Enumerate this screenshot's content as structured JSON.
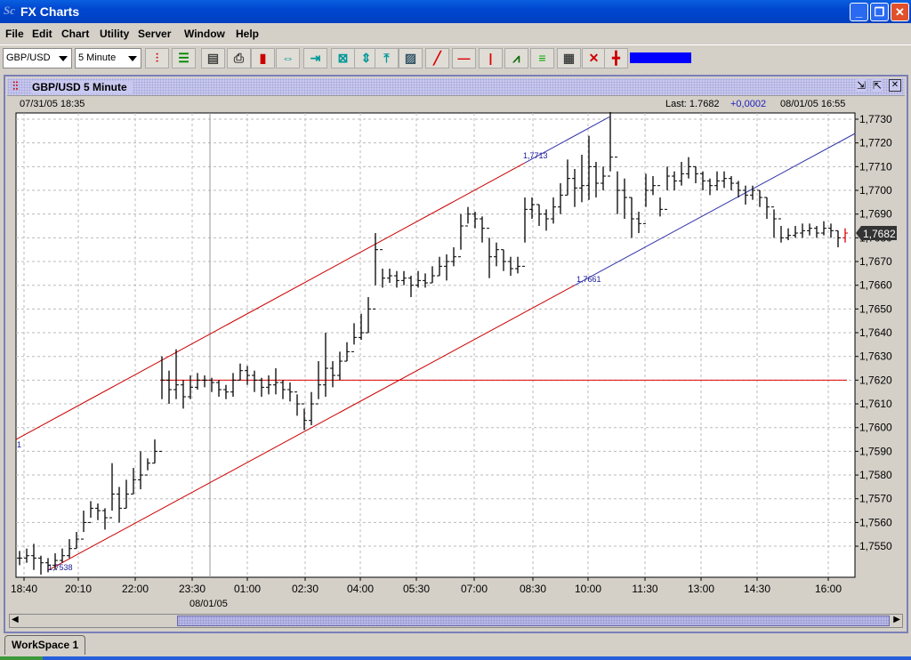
{
  "window": {
    "title": "FX Charts",
    "logo": "Sc"
  },
  "menu": [
    "File",
    "Edit",
    "Chart",
    "Utility",
    "Server",
    "Window",
    "Help"
  ],
  "toolbar": {
    "symbol": "GBP/USD",
    "interval": "5 Minute",
    "buttons": [
      "bar-chart-icon",
      "list-icon",
      "server-icon",
      "print-icon",
      "candle-icon",
      "expand-horizontal-icon",
      "compress-horizontal-icon",
      "fit-icon",
      "expand-vertical-icon",
      "compress-vertical-icon",
      "zoom-select-icon",
      "trendline-icon",
      "horizontal-line-icon",
      "vertical-line-icon",
      "indicator-icon",
      "fibonacci-icon",
      "grid-icon",
      "delete-icon",
      "crosshair-icon"
    ],
    "color_swatch": "#0000ff"
  },
  "chart_window": {
    "title": "GBP/USD 5 Minute",
    "start_time": "07/31/05 18:35",
    "last_label": "Last: 1.7682",
    "change": "+0,0002",
    "end_time": "08/01/05 16:55",
    "date_label": "08/01/05",
    "workspace_tab": "WorkSpace 1"
  },
  "chart_data": {
    "type": "ohlc-bar",
    "ylim": [
      1.7535,
      1.7735
    ],
    "y_ticks": [
      "1,7730",
      "1,7720",
      "1,7710",
      "1,7700",
      "1,7690",
      "1,7680",
      "1,7670",
      "1,7660",
      "1,7650",
      "1,7640",
      "1,7630",
      "1,7620",
      "1,7610",
      "1,7600",
      "1,7590",
      "1,7580",
      "1,7570",
      "1,7560",
      "1,7550"
    ],
    "x_ticks": [
      "18:40",
      "20:10",
      "22:00",
      "23:30",
      "01:00",
      "02:30",
      "04:00",
      "05:30",
      "07:00",
      "08:30",
      "10:00",
      "11:30",
      "13:00",
      "14:30",
      "16:00"
    ],
    "last_price": "1,7682",
    "bars_format": [
      "close",
      "high",
      "low"
    ],
    "bars": [
      [
        1.7545,
        1.7548,
        1.7542
      ],
      [
        1.7546,
        1.7549,
        1.7543
      ],
      [
        1.7545,
        1.7551,
        1.754
      ],
      [
        1.7543,
        1.7546,
        1.7538
      ],
      [
        1.7542,
        1.7545,
        1.7539
      ],
      [
        1.7544,
        1.7547,
        1.754
      ],
      [
        1.7546,
        1.7549,
        1.7543
      ],
      [
        1.7549,
        1.7553,
        1.7545
      ],
      [
        1.7553,
        1.7556,
        1.7549
      ],
      [
        1.756,
        1.7565,
        1.7556
      ],
      [
        1.7566,
        1.7569,
        1.7562
      ],
      [
        1.7565,
        1.7568,
        1.7561
      ],
      [
        1.7562,
        1.7566,
        1.7557
      ],
      [
        1.7572,
        1.7585,
        1.7565
      ],
      [
        1.7566,
        1.7575,
        1.756
      ],
      [
        1.7572,
        1.7578,
        1.7566
      ],
      [
        1.7578,
        1.7583,
        1.7572
      ],
      [
        1.758,
        1.759,
        1.7574
      ],
      [
        1.7585,
        1.7587,
        1.7582
      ],
      [
        1.759,
        1.7595,
        1.7585
      ],
      [
        1.762,
        1.763,
        1.7612
      ],
      [
        1.7616,
        1.7624,
        1.761
      ],
      [
        1.7618,
        1.7633,
        1.7612
      ],
      [
        1.7613,
        1.762,
        1.7608
      ],
      [
        1.7617,
        1.7622,
        1.7612
      ],
      [
        1.762,
        1.7623,
        1.7616
      ],
      [
        1.762,
        1.7622,
        1.7617
      ],
      [
        1.7619,
        1.7621,
        1.7615
      ],
      [
        1.7616,
        1.762,
        1.7613
      ],
      [
        1.7615,
        1.7618,
        1.7612
      ],
      [
        1.762,
        1.7623,
        1.7613
      ],
      [
        1.7624,
        1.7627,
        1.762
      ],
      [
        1.7622,
        1.7626,
        1.7618
      ],
      [
        1.762,
        1.7624,
        1.7615
      ],
      [
        1.7617,
        1.7621,
        1.7613
      ],
      [
        1.7618,
        1.7622,
        1.7614
      ],
      [
        1.7619,
        1.7625,
        1.7614
      ],
      [
        1.7616,
        1.762,
        1.7612
      ],
      [
        1.7615,
        1.7619,
        1.7611
      ],
      [
        1.761,
        1.7614,
        1.7605
      ],
      [
        1.7603,
        1.7608,
        1.7599
      ],
      [
        1.761,
        1.7615,
        1.7601
      ],
      [
        1.7618,
        1.7628,
        1.7612
      ],
      [
        1.7625,
        1.764,
        1.7613
      ],
      [
        1.7622,
        1.7628,
        1.7617
      ],
      [
        1.7628,
        1.7632,
        1.762
      ],
      [
        1.7632,
        1.7636,
        1.7628
      ],
      [
        1.7638,
        1.7644,
        1.7635
      ],
      [
        1.764,
        1.7648,
        1.7637
      ],
      [
        1.765,
        1.7655,
        1.764
      ],
      [
        1.7675,
        1.7682,
        1.766
      ],
      [
        1.7663,
        1.7667,
        1.7659
      ],
      [
        1.7664,
        1.7667,
        1.7661
      ],
      [
        1.7662,
        1.7666,
        1.7659
      ],
      [
        1.7663,
        1.7666,
        1.766
      ],
      [
        1.766,
        1.7664,
        1.7655
      ],
      [
        1.7662,
        1.7666,
        1.7659
      ],
      [
        1.7661,
        1.7665,
        1.7659
      ],
      [
        1.7664,
        1.7668,
        1.7661
      ],
      [
        1.7668,
        1.7672,
        1.7664
      ],
      [
        1.767,
        1.7673,
        1.7662
      ],
      [
        1.7672,
        1.7676,
        1.7668
      ],
      [
        1.7685,
        1.769,
        1.7675
      ],
      [
        1.769,
        1.7693,
        1.7686
      ],
      [
        1.7688,
        1.7691,
        1.7684
      ],
      [
        1.7684,
        1.7689,
        1.7678
      ],
      [
        1.7672,
        1.768,
        1.7663
      ],
      [
        1.7675,
        1.7678,
        1.7668
      ],
      [
        1.767,
        1.7675,
        1.7666
      ],
      [
        1.7667,
        1.7672,
        1.7664
      ],
      [
        1.7668,
        1.7672,
        1.7665
      ],
      [
        1.7692,
        1.7697,
        1.7678
      ],
      [
        1.7694,
        1.7697,
        1.7688
      ],
      [
        1.769,
        1.7694,
        1.7685
      ],
      [
        1.7688,
        1.7692,
        1.7683
      ],
      [
        1.7693,
        1.7697,
        1.7686
      ],
      [
        1.7698,
        1.7703,
        1.769
      ],
      [
        1.7705,
        1.7713,
        1.7698
      ],
      [
        1.7701,
        1.7709,
        1.7693
      ],
      [
        1.7702,
        1.7715,
        1.7695
      ],
      [
        1.771,
        1.7723,
        1.7696
      ],
      [
        1.7703,
        1.7712,
        1.7697
      ],
      [
        1.7706,
        1.771,
        1.77
      ],
      [
        1.7714,
        1.7733,
        1.7708
      ],
      [
        1.77,
        1.7708,
        1.769
      ],
      [
        1.7697,
        1.7705,
        1.7688
      ],
      [
        1.7688,
        1.7697,
        1.768
      ],
      [
        1.7686,
        1.7691,
        1.7682
      ],
      [
        1.77,
        1.7707,
        1.7693
      ],
      [
        1.7702,
        1.7706,
        1.7698
      ],
      [
        1.7692,
        1.7697,
        1.7689
      ],
      [
        1.7706,
        1.771,
        1.77
      ],
      [
        1.7704,
        1.7708,
        1.77
      ],
      [
        1.7707,
        1.7712,
        1.7702
      ],
      [
        1.771,
        1.7714,
        1.7705
      ],
      [
        1.7707,
        1.771,
        1.7703
      ],
      [
        1.7704,
        1.7708,
        1.77
      ],
      [
        1.7702,
        1.7705,
        1.7698
      ],
      [
        1.7704,
        1.7708,
        1.77
      ],
      [
        1.7705,
        1.7708,
        1.7701
      ],
      [
        1.7703,
        1.7706,
        1.77
      ],
      [
        1.77,
        1.7704,
        1.7697
      ],
      [
        1.7698,
        1.7702,
        1.7694
      ],
      [
        1.77,
        1.7702,
        1.7696
      ],
      [
        1.7697,
        1.77,
        1.7693
      ],
      [
        1.7693,
        1.7697,
        1.7688
      ],
      [
        1.7688,
        1.7692,
        1.768
      ],
      [
        1.768,
        1.7685,
        1.7678
      ],
      [
        1.7681,
        1.7684,
        1.7679
      ],
      [
        1.7682,
        1.7685,
        1.768
      ],
      [
        1.7683,
        1.7686,
        1.768
      ],
      [
        1.7684,
        1.7686,
        1.7681
      ],
      [
        1.7682,
        1.7685,
        1.768
      ],
      [
        1.7684,
        1.7687,
        1.7681
      ],
      [
        1.7683,
        1.7686,
        1.768
      ],
      [
        1.768,
        1.7683,
        1.7676
      ],
      [
        1.7682,
        1.7684,
        1.7678
      ]
    ],
    "horizontal_line": 1.762,
    "trendlines": [
      {
        "label": "1,7713",
        "from": [
          1.7595
        ],
        "to": [
          1.7731
        ],
        "colors": [
          "#cc0000",
          "#3333aa"
        ]
      },
      {
        "label": "1,7661",
        "from": [
          1.754
        ],
        "to": [
          1.7724
        ],
        "colors": [
          "#cc0000",
          "#3333aa"
        ]
      }
    ],
    "annotations": [
      "1,7538",
      "1"
    ],
    "grid": true
  }
}
